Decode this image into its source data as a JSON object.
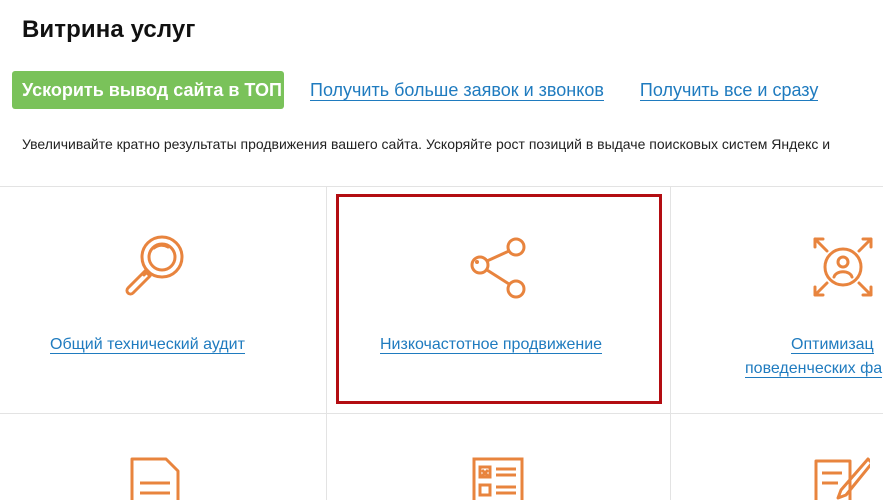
{
  "page": {
    "title": "Витрина услуг",
    "description": "Увеличивайте кратно результаты продвижения вашего сайта. Ускоряйте рост позиций в выдаче поисковых систем Яндекс и"
  },
  "tabs": [
    {
      "label": "Ускорить вывод сайта в ТОП",
      "active": true
    },
    {
      "label": "Получить больше заявок и звонков",
      "active": false
    },
    {
      "label": "Получить все и сразу",
      "active": false
    }
  ],
  "services": [
    {
      "label": "Общий технический аудит",
      "icon": "magnifier-icon"
    },
    {
      "label": "Низкочастотное продвижение",
      "icon": "share-icon",
      "selected": true
    },
    {
      "label_line1": "Оптимизац",
      "label_line2": "поведенческих фа",
      "icon": "target-person-icon"
    }
  ],
  "services_row2_icons": [
    "document-icon",
    "checklist-icon",
    "edit-icon"
  ],
  "colors": {
    "accent_green": "#7ac25a",
    "link_blue": "#1f7bbf",
    "icon_orange": "#e8843e",
    "highlight_red": "#b30d12"
  }
}
